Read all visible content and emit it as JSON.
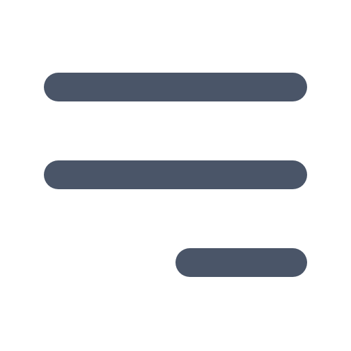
{
  "icon": {
    "name": "menu-align-right-icon",
    "color": "#4a5568",
    "background": "#ffffff"
  }
}
